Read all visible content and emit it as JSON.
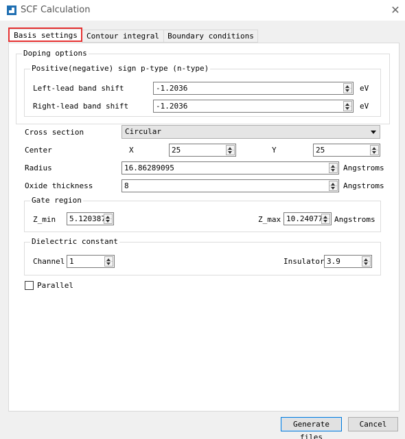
{
  "window": {
    "title": "SCF Calculation"
  },
  "tabs": [
    {
      "label": "Basis settings",
      "active": true
    },
    {
      "label": "Contour integral",
      "active": false
    },
    {
      "label": "Boundary conditions",
      "active": false
    }
  ],
  "doping": {
    "title": "Doping options",
    "subgroup_title": "Positive(negative) sign p-type (n-type)",
    "left_lead": {
      "label": "Left-lead band shift",
      "value": "-1.2036",
      "unit": "eV"
    },
    "right_lead": {
      "label": "Right-lead band shift",
      "value": "-1.2036",
      "unit": "eV"
    }
  },
  "cross_section": {
    "label": "Cross section",
    "value": "Circular"
  },
  "center": {
    "label": "Center",
    "x_label": "X",
    "x_value": "25",
    "y_label": "Y",
    "y_value": "25"
  },
  "radius": {
    "label": "Radius",
    "value": "16.86289095",
    "unit": "Angstroms"
  },
  "oxide": {
    "label": "Oxide thickness",
    "value": "8",
    "unit": "Angstroms"
  },
  "gate": {
    "title": "Gate region",
    "zmin_label": "Z_min",
    "zmin_value": "5.120387",
    "zmax_label": "Z_max",
    "zmax_value": "10.24077",
    "unit": "Angstroms"
  },
  "dielectric": {
    "title": "Dielectric constant",
    "channel_label": "Channel",
    "channel_value": "1",
    "insulator_label": "Insulator",
    "insulator_value": "3.9"
  },
  "parallel": {
    "label": "Parallel",
    "checked": false
  },
  "buttons": {
    "generate": "Generate files",
    "cancel": "Cancel"
  },
  "colors": {
    "highlight": "#e53030",
    "accent": "#0078d7",
    "icon": "#1f6fb2"
  }
}
